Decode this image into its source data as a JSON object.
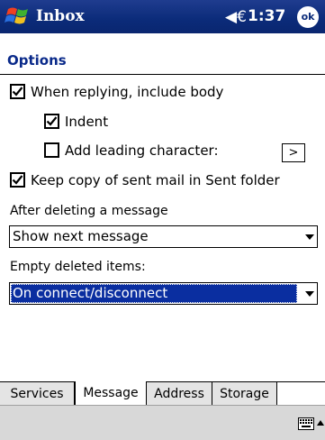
{
  "titlebar": {
    "app_title": "Inbox",
    "volume_glyph": "◀€",
    "time": "1:37",
    "ok_label": "ok"
  },
  "page": {
    "title": "Options"
  },
  "options": {
    "include_body": {
      "label": "When replying, include body",
      "checked": true
    },
    "indent": {
      "label": "Indent",
      "checked": true
    },
    "leading_char": {
      "label": "Add leading character:",
      "checked": false,
      "button_label": ">"
    },
    "keep_copy": {
      "label": "Keep copy of sent mail in Sent folder",
      "checked": true
    },
    "after_delete": {
      "label": "After deleting a message",
      "value": "Show next message"
    },
    "empty_deleted": {
      "label": "Empty deleted items:",
      "value": "On connect/disconnect"
    }
  },
  "tabs": [
    {
      "label": "Services",
      "active": false
    },
    {
      "label": "Message",
      "active": true
    },
    {
      "label": "Address",
      "active": false
    },
    {
      "label": "Storage",
      "active": false
    }
  ],
  "icons": {
    "start": "windows-flag-icon",
    "volume": "speaker-icon",
    "keyboard": "keyboard-icon"
  }
}
